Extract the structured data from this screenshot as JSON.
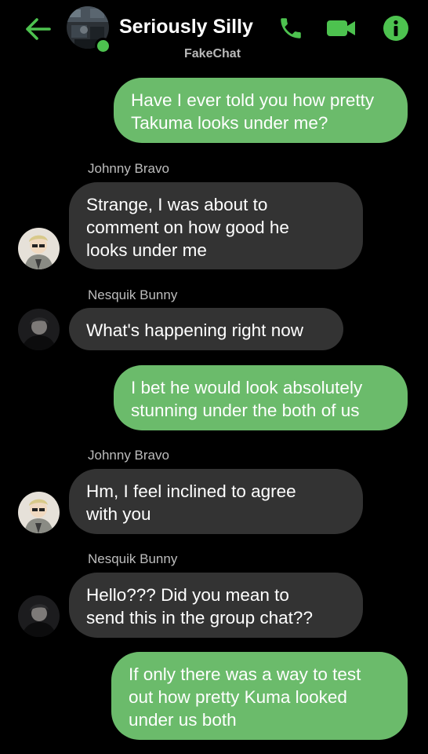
{
  "header": {
    "title": "Seriously Silly",
    "subtitle": "FakeChat",
    "icons": {
      "back": "arrow-left-icon",
      "call": "phone-icon",
      "video": "video-camera-icon",
      "info": "info-icon"
    },
    "status": "online"
  },
  "colors": {
    "accent": "#4dc24f",
    "outgoing_bubble": "#6bbb6b",
    "incoming_bubble": "#333333",
    "background": "#000000"
  },
  "messages": [
    {
      "direction": "outgoing",
      "lines": [
        "Have I ever told you how pretty",
        "Takuma looks under me?"
      ]
    },
    {
      "direction": "incoming",
      "sender": "Johnny Bravo",
      "lines": [
        "Strange, I was about to",
        "comment on how good he",
        "looks under me"
      ]
    },
    {
      "direction": "incoming",
      "sender": "Nesquik Bunny",
      "lines": [
        "What's happening right now"
      ]
    },
    {
      "direction": "outgoing",
      "lines": [
        "I bet he would look absolutely",
        "stunning under the both of us"
      ]
    },
    {
      "direction": "incoming",
      "sender": "Johnny Bravo",
      "lines": [
        "Hm, I feel inclined to agree",
        "with you"
      ]
    },
    {
      "direction": "incoming",
      "sender": "Nesquik Bunny",
      "lines": [
        "Hello???  Did you mean to",
        "send this in the group chat??"
      ]
    },
    {
      "direction": "outgoing",
      "lines": [
        "If only there was a way to test",
        "out how pretty Kuma looked",
        "under us both"
      ]
    }
  ]
}
